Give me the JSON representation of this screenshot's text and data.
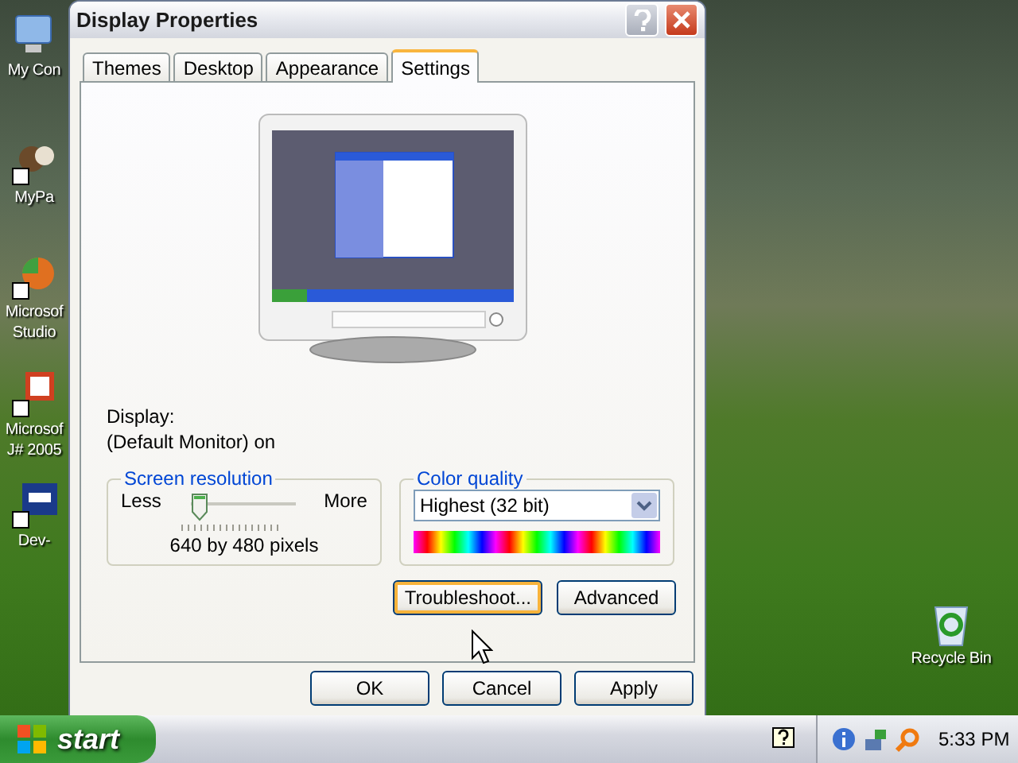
{
  "desktop_icons": [
    {
      "label": "My Con",
      "kind": "computer"
    },
    {
      "label": "MyPa",
      "kind": "shortcut"
    },
    {
      "label": "Microsof\nStudio",
      "kind": "studio"
    },
    {
      "label": "Microsof\nJ# 2005",
      "kind": "jsharp"
    },
    {
      "label": "Dev-",
      "kind": "dev"
    },
    {
      "label": "Recycle Bin",
      "kind": "recycle"
    }
  ],
  "window": {
    "title": "Display Properties",
    "tabs": [
      {
        "label": "Themes",
        "selected": false
      },
      {
        "label": "Desktop",
        "selected": false
      },
      {
        "label": "Appearance",
        "selected": false
      },
      {
        "label": "Settings",
        "selected": true
      }
    ],
    "display_label": "Display:",
    "display_value": "(Default Monitor) on",
    "screen_resolution": {
      "title": "Screen resolution",
      "min_label": "Less",
      "max_label": "More",
      "level": 0,
      "value": "640 by 480 pixels"
    },
    "color_quality": {
      "title": "Color quality",
      "value": "Highest (32 bit)"
    },
    "buttons": [
      {
        "label": "Troubleshoot...",
        "hover": true
      },
      {
        "label": "Advanced",
        "hover": false
      }
    ],
    "dialog_buttons": [
      {
        "label": "OK"
      },
      {
        "label": "Cancel"
      },
      {
        "label": "Apply"
      }
    ]
  },
  "taskbar": {
    "start": "start",
    "clock": "5:33 PM"
  }
}
